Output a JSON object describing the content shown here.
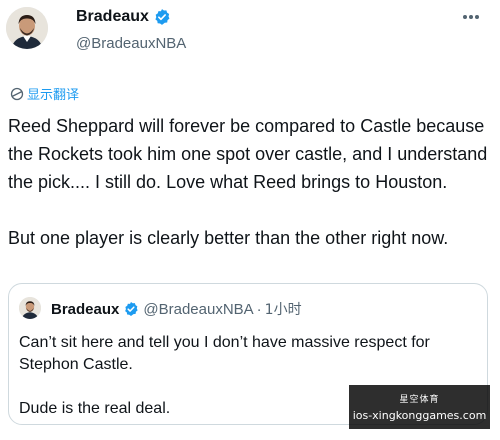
{
  "author": {
    "display_name": "Bradeaux",
    "handle": "@BradeauxNBA",
    "verified": true
  },
  "translate": {
    "icon": "globe-icon",
    "label": "显示翻译"
  },
  "tweet": {
    "paragraphs": [
      "Reed Sheppard will forever be compared to Castle because the Rockets took him one spot over castle, and I understand the pick.... I still do. Love what Reed brings to Houston.",
      "But one player is clearly better than the other right now."
    ]
  },
  "quoted": {
    "display_name": "Bradeaux",
    "handle": "@BradeauxNBA",
    "separator": "·",
    "time": "1小时",
    "paragraphs": [
      "Can’t sit here and tell you I don’t have massive respect for Stephon Castle.",
      "Dude is the real deal."
    ]
  },
  "watermark": {
    "line1": "星空体育",
    "line2": "ios-xingkonggames.com"
  },
  "colors": {
    "accent": "#1d9bf0",
    "text": "#0f1419",
    "muted": "#536471",
    "border": "#cfd9de"
  }
}
